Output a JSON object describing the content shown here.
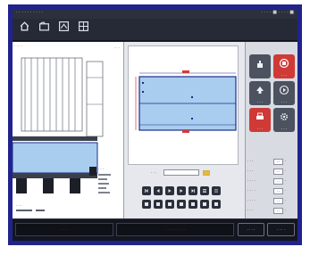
{
  "window": {
    "title": "· · · · · · ·   · · ·",
    "status": "· · · ·   ■  · · · ·   ■"
  },
  "toolbar": {
    "buttons": [
      {
        "name": "home",
        "icon": "home-icon",
        "label": ""
      },
      {
        "name": "file",
        "icon": "folder-icon",
        "label": ""
      },
      {
        "name": "drawing",
        "icon": "drawing-icon",
        "label": ""
      },
      {
        "name": "settings",
        "icon": "grid-icon",
        "label": ""
      }
    ]
  },
  "left_panel": {
    "header": "· · · ·",
    "header_right": "· · ·",
    "readout": "· · ·",
    "footer": "· · ·"
  },
  "center": {
    "field_label": "· · ·",
    "field_value": "",
    "drawing": {
      "fill": "#a9cdef",
      "border": "#1d2d8c",
      "accent": "#d43a3a"
    }
  },
  "right_panel": {
    "buttons": [
      {
        "name": "part-tool",
        "icon": "hand-icon",
        "label": "",
        "color": "#4d5260"
      },
      {
        "name": "stop",
        "icon": "stop-icon",
        "label": "· · ·",
        "color": "#cf3a36"
      },
      {
        "name": "up",
        "icon": "upload-icon",
        "label": "· · ·",
        "color": "#4d5260"
      },
      {
        "name": "start",
        "icon": "play-icon",
        "label": "· · ·",
        "color": "#4d5260"
      },
      {
        "name": "print",
        "icon": "printer-icon",
        "label": "· · ·",
        "color": "#cf3a36"
      },
      {
        "name": "config",
        "icon": "gear-icon",
        "label": "· · ·",
        "color": "#4d5260"
      }
    ],
    "params": [
      {
        "label": "· · ·",
        "value": "· ·",
        "unit": "·"
      },
      {
        "label": "· · ·",
        "value": "· ·",
        "unit": "·"
      },
      {
        "label": "· · · ·",
        "value": "· ·",
        "unit": "·"
      },
      {
        "label": "· · · ·",
        "value": "· ·",
        "unit": "·"
      },
      {
        "label": "· · · ·",
        "value": "· ·",
        "unit": "·"
      },
      {
        "label": "· · ·",
        "value": "· ·",
        "unit": "·"
      }
    ]
  },
  "status_bar": {
    "cell_left": "· · · · ·",
    "cell_mid": "· · · · · · · · ·",
    "btn1": "· · · ·",
    "btn2": "· · · ·"
  },
  "colors": {
    "frame": "#20238c",
    "accent_red": "#cf3a36",
    "panel_blue": "#a9cdef"
  }
}
